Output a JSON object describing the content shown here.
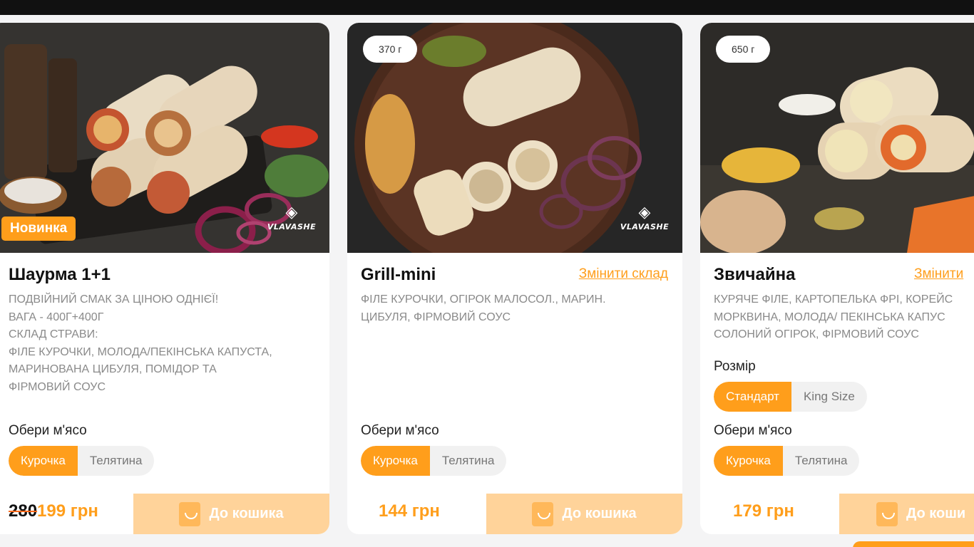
{
  "products": [
    {
      "badge": "Новинка",
      "brand_logo_text": "VLAVASHE",
      "name": "Шаурма 1+1",
      "description_lines": [
        "ПОДВІЙНИЙ СМАК ЗА ЦІНОЮ ОДНІЄЇ!",
        "ВАГА - 400Г+400Г",
        "СКЛАД СТРАВИ:",
        "ФІЛЕ КУРОЧКИ, МОЛОДА/ПЕКІНСЬКА КАПУСТА,",
        "МАРИНОВАНА ЦИБУЛЯ, ПОМІДОР ТА",
        "ФІРМОВИЙ СОУС"
      ],
      "meat_label": "Обери м'ясо",
      "meat_options": [
        "Курочка",
        "Телятина"
      ],
      "old_price": "280",
      "price": "199 грн",
      "cart_label": "До кошика"
    },
    {
      "weight": "370 г",
      "brand_logo_text": "VLAVASHE",
      "name": "Grill-mini",
      "change_label": "Змінити склад",
      "description_lines": [
        "ФІЛЕ КУРОЧКИ, ОГІРОК МАЛОСОЛ., МАРИН.",
        "ЦИБУЛЯ, ФІРМОВИЙ СОУС"
      ],
      "meat_label": "Обери м'ясо",
      "meat_options": [
        "Курочка",
        "Телятина"
      ],
      "price": "144 грн",
      "cart_label": "До кошика"
    },
    {
      "weight": "650 г",
      "name": "Звичайна",
      "change_label": "Змінити",
      "description_lines": [
        "КУРЯЧЕ ФІЛЕ, КАРТОПЕЛЬКА ФРІ, КОРЕЙС",
        "МОРКВИНА, МОЛОДА/ ПЕКІНСЬКА КАПУС",
        "СОЛОНИЙ ОГІРОК, ФІРМОВИЙ СОУС"
      ],
      "size_label": "Розмір",
      "size_options": [
        "Стандарт",
        "King Size"
      ],
      "meat_label": "Обери м'ясо",
      "meat_options": [
        "Курочка",
        "Телятина"
      ],
      "price": "179 грн",
      "cart_label": "До коши"
    }
  ],
  "colors": {
    "accent": "#ff9e1b",
    "cart_bg": "#ffd39a",
    "photo_dark": "#2a2a2a"
  }
}
